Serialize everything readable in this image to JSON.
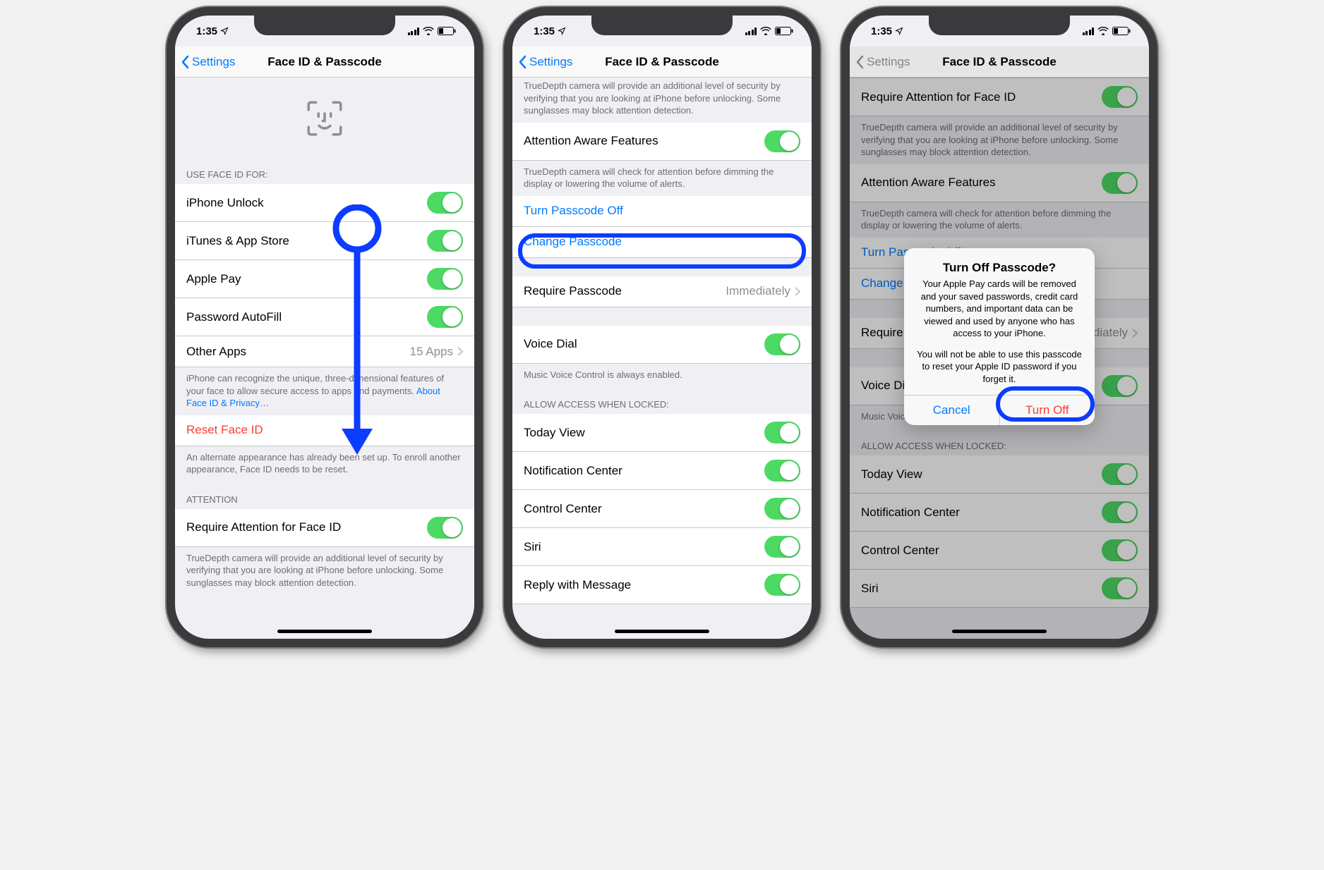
{
  "status": {
    "time": "1:35",
    "locArrow": "➤"
  },
  "nav": {
    "back": "Settings",
    "title": "Face ID & Passcode"
  },
  "screen1": {
    "sectionUseFaceId": "USE FACE ID FOR:",
    "iphoneUnlock": "iPhone Unlock",
    "itunes": "iTunes & App Store",
    "applePay": "Apple Pay",
    "pwdAutofill": "Password AutoFill",
    "otherApps": "Other Apps",
    "otherAppsDetail": "15 Apps",
    "footerFaceId": "iPhone can recognize the unique, three-dimensional features of your face to allow secure access to apps and payments. ",
    "footerFaceIdLink": "About Face ID & Privacy…",
    "resetFaceId": "Reset Face ID",
    "footerReset": "An alternate appearance has already been set up. To enroll another appearance, Face ID needs to be reset.",
    "sectionAttention": "ATTENTION",
    "requireAttention": "Require Attention for Face ID",
    "footerAttention": "TrueDepth camera will provide an additional level of security by verifying that you are looking at iPhone before unlocking. Some sunglasses may block attention detection."
  },
  "screen2": {
    "footerTruedepthPartial": "TrueDepth camera will provide an additional level of security by verifying that you are looking at iPhone before unlocking. Some sunglasses may block attention detection.",
    "attentionAware": "Attention Aware Features",
    "footerAttentionAware": "TrueDepth camera will check for attention before dimming the display or lowering the volume of alerts.",
    "turnPasscodeOff": "Turn Passcode Off",
    "changePasscode": "Change Passcode",
    "requirePasscode": "Require Passcode",
    "requirePasscodeDetail": "Immediately",
    "voiceDial": "Voice Dial",
    "footerVoiceDial": "Music Voice Control is always enabled.",
    "sectionAllowAccess": "ALLOW ACCESS WHEN LOCKED:",
    "todayView": "Today View",
    "notifCenter": "Notification Center",
    "controlCenter": "Control Center",
    "siri": "Siri",
    "replyMsg": "Reply with Message"
  },
  "screen3": {
    "requireAttention": "Require Attention for Face ID",
    "footerTruedepth": "TrueDepth camera will provide an additional level of security by verifying that you are looking at iPhone before unlocking. Some sunglasses may block attention detection.",
    "attentionAware": "Attention Aware Features",
    "footerAttentionAware": "TrueDepth camera will check for attention before dimming the display or lowering the volume of alerts.",
    "turnPasscodeOff": "Turn Passcode Off",
    "changePasscode": "Change Passcode",
    "requirePasscode": "Require Passcode",
    "requirePasscodeDetail": "Immediately",
    "voiceDial": "Voice Dial",
    "footerVoiceDial": "Music Voice Control is always enabled.",
    "sectionAllowAccess": "ALLOW ACCESS WHEN LOCKED:",
    "todayView": "Today View",
    "notifCenter": "Notification Center",
    "controlCenter": "Control Center",
    "siri": "Siri",
    "alert": {
      "title": "Turn Off Passcode?",
      "msg1": "Your Apple Pay cards will be removed and your saved passwords, credit card numbers, and important data can be viewed and used by anyone who has access to your iPhone.",
      "msg2": "You will not be able to use this passcode to reset your Apple ID password if you forget it.",
      "cancel": "Cancel",
      "turnOff": "Turn Off"
    }
  }
}
